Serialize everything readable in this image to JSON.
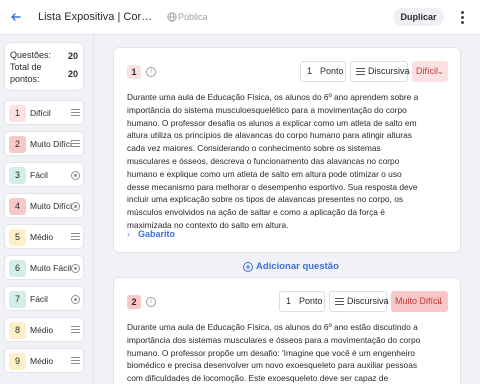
{
  "header": {
    "back_icon": "arrow-left-icon",
    "title": "Lista Expositiva | Corpo Humano",
    "visibility_icon": "globe-icon",
    "visibility": "Pública",
    "duplicate_label": "Duplicar",
    "more_icon": "vertical-dots-icon"
  },
  "summary": {
    "questions_label": "Questões:",
    "questions_value": "20",
    "points_label": "Total de pontos:",
    "points_value": "20"
  },
  "sidebar": {
    "items": [
      {
        "number": "1",
        "label": "Difícil",
        "icon": "lines-icon",
        "color": "#fbe1e1"
      },
      {
        "number": "2",
        "label": "Muito Difícil",
        "icon": "lines-icon",
        "color": "#f8c8c8"
      },
      {
        "number": "3",
        "label": "Fácil",
        "icon": "radio-icon",
        "color": "#d4ede9"
      },
      {
        "number": "4",
        "label": "Muito Difícil",
        "icon": "radio-icon",
        "color": "#f8c8c8"
      },
      {
        "number": "5",
        "label": "Médio",
        "icon": "lines-icon",
        "color": "#fdf0c8"
      },
      {
        "number": "6",
        "label": "Muito Fácil",
        "icon": "radio-icon",
        "color": "#d4ede9"
      },
      {
        "number": "7",
        "label": "Fácil",
        "icon": "radio-icon",
        "color": "#d4ede9"
      },
      {
        "number": "8",
        "label": "Médio",
        "icon": "lines-icon",
        "color": "#fdf0c8"
      },
      {
        "number": "9",
        "label": "Médio",
        "icon": "lines-icon",
        "color": "#fdf0c8"
      }
    ]
  },
  "questions": [
    {
      "number": "1",
      "points": "1",
      "points_unit": "Ponto",
      "type": "Discursiva",
      "difficulty": "Difícil",
      "text": "Durante uma aula de Educação Física, os alunos do 6º ano aprendem sobre a importância do sistema musculoesquelético para a movimentação do corpo humano. O professor desafia os alunos a explicar como um atleta de salto em altura utiliza os princípios de alavancas do corpo humano para atingir alturas cada vez maiores. Considerando o conhecimento sobre os sistemas musculares e ósseos, descreva o funcionamento das alavancas no corpo humano e explique como um atleta de salto em altura pode otimizar o uso desse mecanismo para melhorar o desempenho esportivo. Sua resposta deve incluir uma explicação sobre os tipos de alavancas presentes no corpo, os músculos envolvidos na ação de saltar e como a aplicação da força é maximizada no contexto do salto em altura.",
      "gabarito_label": "Gabarito"
    },
    {
      "number": "2",
      "points": "1",
      "points_unit": "Ponto",
      "type": "Discursiva",
      "difficulty": "Muito Difícil",
      "text": "Durante uma aula de Educação Física, os alunos do 6º ano estão discutindo a importância dos sistemas musculares e ósseos para a movimentação do corpo humano. O professor propõe um desafio: 'Imagine que você é um engenheiro biomédico e precisa desenvolver um novo exoesqueleto para auxiliar pessoas com dificuldades de locomoção. Este exoesqueleto deve ser capaz de mimetizar o"
    }
  ],
  "add_question_label": "Adicionar questão",
  "colors": {
    "accent": "#3f6fd8",
    "hard_bg": "#fbe1e1",
    "very_hard_bg": "#f8c8c8",
    "hard_text": "#c23a3a"
  }
}
